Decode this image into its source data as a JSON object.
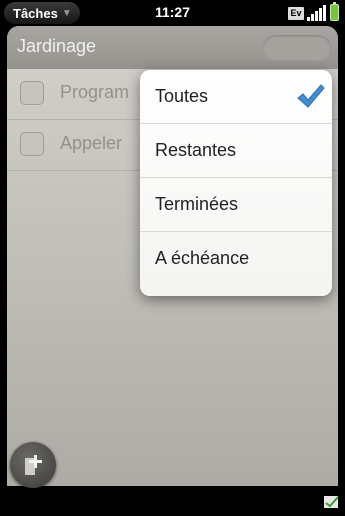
{
  "status_bar": {
    "app_menu_label": "Tâches",
    "time": "11:27",
    "network_label": "Ev"
  },
  "card": {
    "title": "Jardinage",
    "tasks": [
      {
        "label": "Program"
      },
      {
        "label": "Appeler"
      }
    ]
  },
  "filter_menu": {
    "items": [
      {
        "label": "Toutes",
        "selected": true
      },
      {
        "label": "Restantes",
        "selected": false
      },
      {
        "label": "Terminées",
        "selected": false
      },
      {
        "label": "A échéance",
        "selected": false
      }
    ]
  },
  "colors": {
    "check_accent": "#3d8fd6",
    "battery": "#76c43a"
  },
  "icons": [
    "chevron-down-icon",
    "ev-network-icon",
    "signal-bars-icon",
    "battery-icon",
    "new-task-icon",
    "notification-icon",
    "checkmark-icon"
  ]
}
